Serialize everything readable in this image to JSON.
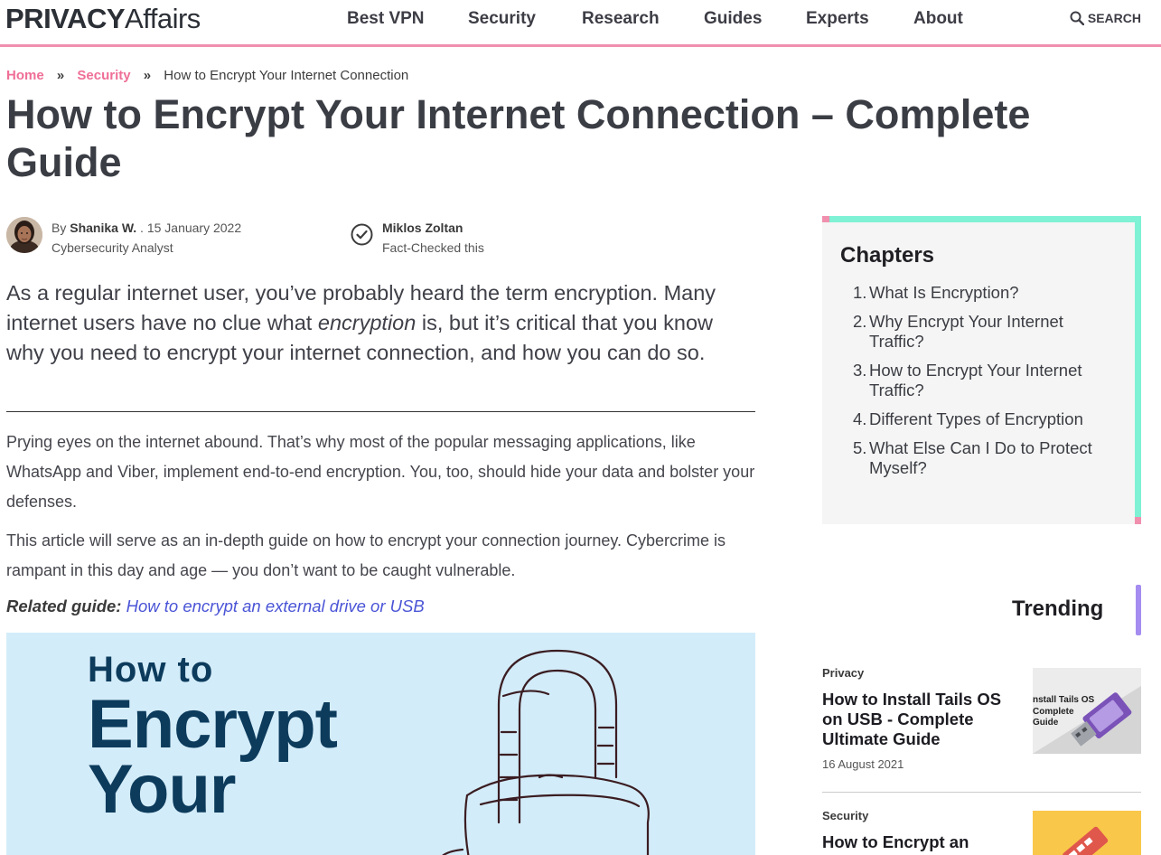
{
  "header": {
    "logo_bold": "PRIVACY",
    "logo_light": "Affairs",
    "nav": [
      "Best VPN",
      "Security",
      "Research",
      "Guides",
      "Experts",
      "About"
    ],
    "search_label": "SEARCH",
    "accent_color": "#f08fae"
  },
  "breadcrumb": {
    "home": "Home",
    "category": "Security",
    "sep": "»",
    "current": "How to Encrypt Your Internet Connection"
  },
  "article": {
    "title": "How to Encrypt Your Internet Connection – Complete Guide",
    "author_prefix": "By",
    "author_name": "Shanika W.",
    "date": ". 15 January 2022",
    "author_role": "Cybersecurity Analyst",
    "checker_name": "Miklos Zoltan",
    "checker_note": "Fact-Checked this",
    "intro_a": "As a regular internet user, you’ve probably heard the term encryption. Many internet users have no clue what ",
    "intro_em": "encryption",
    "intro_b": " is, but it’s critical that you know why you need to encrypt your internet connection, and how you can do so.",
    "para1": "Prying eyes on the internet abound. That’s why most of the popular messaging applications, like WhatsApp and Viber, implement end-to-end encryption. You, too, should hide your data and bolster your defenses.",
    "para2": "This article will serve as an in-depth guide on how to encrypt your connection journey. Cybercrime is rampant in this day and age — you don’t want to be caught vulnerable.",
    "related_label": "Related guide:",
    "related_link": "How to encrypt an external drive or USB",
    "hero_line1": "How to",
    "hero_line2": "Encrypt",
    "hero_line3": "Your",
    "hero_bg": "#d3ecf9"
  },
  "chapters": {
    "title": "Chapters",
    "items": [
      {
        "num": "1.",
        "label": "What Is Encryption?"
      },
      {
        "num": "2.",
        "label": "Why Encrypt Your Internet Traffic?"
      },
      {
        "num": "3.",
        "label": "How to Encrypt Your Internet Traffic?"
      },
      {
        "num": "4.",
        "label": "Different Types of Encryption"
      },
      {
        "num": "5.",
        "label": "What Else Can I Do to Protect Myself?"
      }
    ]
  },
  "trending": {
    "title": "Trending",
    "items": [
      {
        "category": "Privacy",
        "title": "How to Install Tails OS on USB - Complete Ultimate Guide",
        "date": "16 August 2021",
        "thumb_text": "Install Tails OS\nComplete\nGuide"
      },
      {
        "category": "Security",
        "title": "How to Encrypt an"
      }
    ]
  }
}
